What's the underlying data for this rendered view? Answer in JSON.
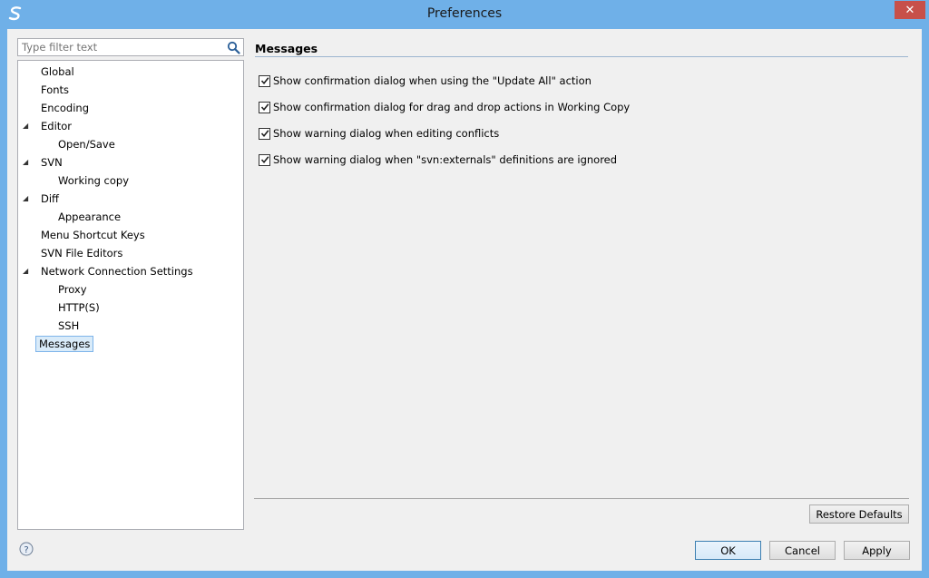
{
  "window": {
    "title": "Preferences"
  },
  "filter": {
    "placeholder": "Type filter text"
  },
  "tree": {
    "items": [
      {
        "label": "Global",
        "level": 0,
        "expanded": null,
        "selected": false
      },
      {
        "label": "Fonts",
        "level": 0,
        "expanded": null,
        "selected": false
      },
      {
        "label": "Encoding",
        "level": 0,
        "expanded": null,
        "selected": false
      },
      {
        "label": "Editor",
        "level": 0,
        "expanded": true,
        "selected": false
      },
      {
        "label": "Open/Save",
        "level": 1,
        "expanded": null,
        "selected": false
      },
      {
        "label": "SVN",
        "level": 0,
        "expanded": true,
        "selected": false
      },
      {
        "label": "Working copy",
        "level": 1,
        "expanded": null,
        "selected": false
      },
      {
        "label": "Diff",
        "level": 0,
        "expanded": true,
        "selected": false
      },
      {
        "label": "Appearance",
        "level": 1,
        "expanded": null,
        "selected": false
      },
      {
        "label": "Menu Shortcut Keys",
        "level": 0,
        "expanded": null,
        "selected": false
      },
      {
        "label": "SVN File Editors",
        "level": 0,
        "expanded": null,
        "selected": false
      },
      {
        "label": "Network Connection Settings",
        "level": 0,
        "expanded": true,
        "selected": false
      },
      {
        "label": "Proxy",
        "level": 1,
        "expanded": null,
        "selected": false
      },
      {
        "label": "HTTP(S)",
        "level": 1,
        "expanded": null,
        "selected": false
      },
      {
        "label": "SSH",
        "level": 1,
        "expanded": null,
        "selected": false
      },
      {
        "label": "Messages",
        "level": 0,
        "expanded": null,
        "selected": true
      }
    ]
  },
  "main": {
    "heading": "Messages",
    "options": [
      {
        "label": "Show confirmation dialog when using the \"Update All\" action",
        "checked": true
      },
      {
        "label": "Show confirmation dialog for drag and drop actions in Working Copy",
        "checked": true
      },
      {
        "label": "Show warning dialog when editing conflicts",
        "checked": true
      },
      {
        "label": "Show warning dialog when \"svn:externals\" definitions are ignored",
        "checked": true
      }
    ],
    "restore_defaults_label": "Restore Defaults"
  },
  "footer": {
    "ok_label": "OK",
    "cancel_label": "Cancel",
    "apply_label": "Apply"
  },
  "colors": {
    "frame": "#6fb0e8",
    "close_button": "#c7504a",
    "selection": "#d9ebf9"
  }
}
